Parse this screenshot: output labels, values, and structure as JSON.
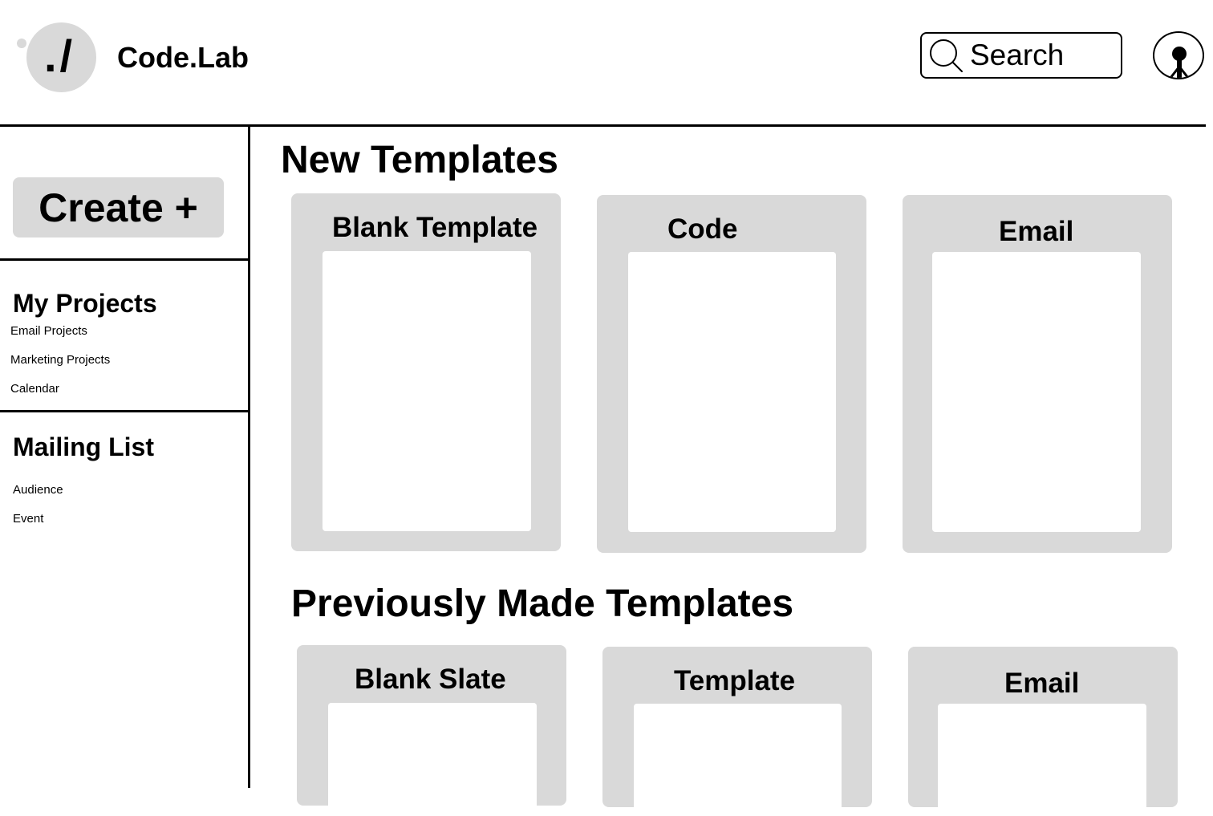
{
  "header": {
    "logo_mark": "./",
    "brand": "Code.Lab",
    "search_placeholder": "Search"
  },
  "sidebar": {
    "create_label": "Create +",
    "projects": {
      "heading": "My Projects",
      "items": [
        "Email Projects",
        "Marketing Projects",
        "Calendar"
      ]
    },
    "mailing": {
      "heading": "Mailing List",
      "items": [
        "Audience",
        "Event"
      ]
    }
  },
  "main": {
    "new_templates": {
      "title": "New Templates",
      "cards": [
        "Blank Template",
        "Code",
        "Email"
      ]
    },
    "previous_templates": {
      "title": "Previously Made Templates",
      "cards": [
        "Blank Slate",
        "Template",
        "Email"
      ]
    }
  },
  "colors": {
    "panel_gray": "#d9d9d9",
    "line": "#000000",
    "background": "#ffffff"
  }
}
